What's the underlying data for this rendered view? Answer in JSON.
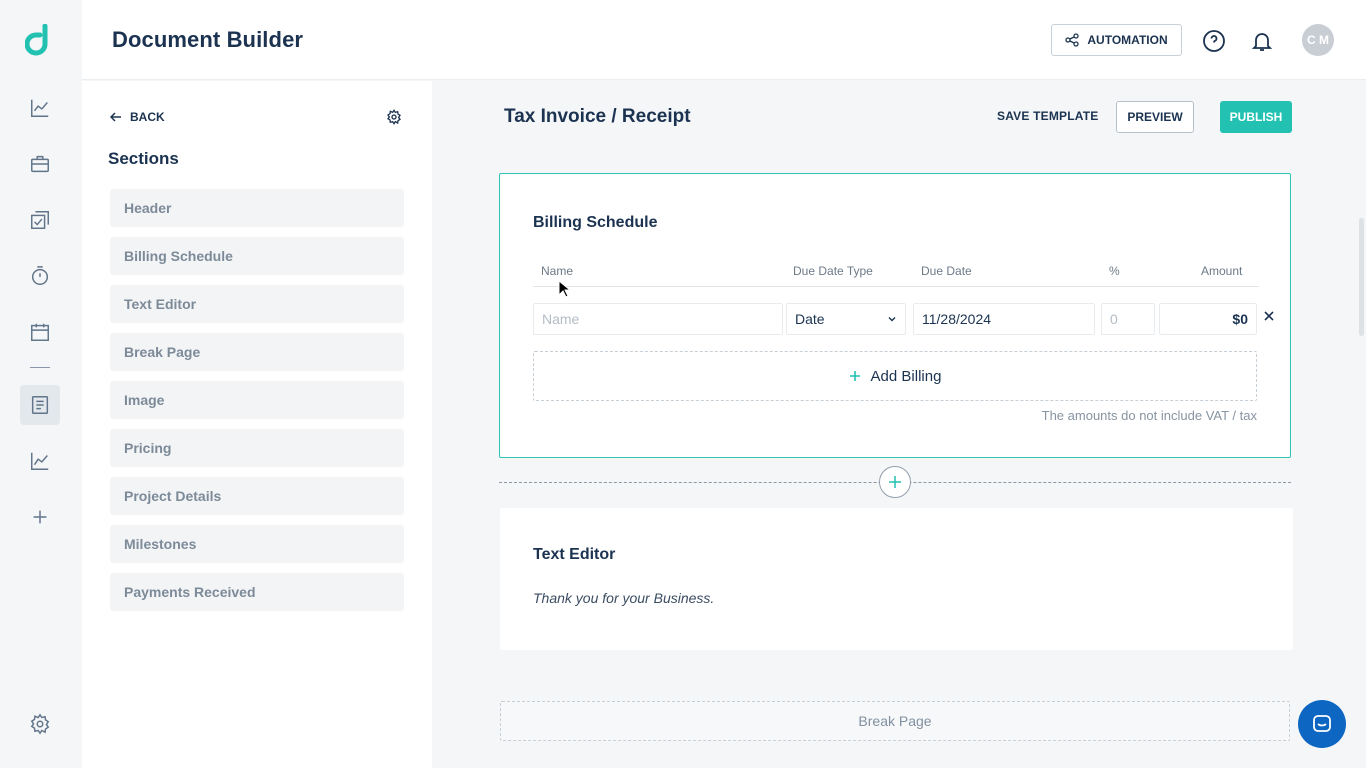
{
  "header": {
    "title": "Document Builder",
    "automation_label": "AUTOMATION",
    "avatar_initials": "C M"
  },
  "sidebar_panel": {
    "back_label": "BACK",
    "sections_title": "Sections",
    "items": [
      {
        "label": "Header"
      },
      {
        "label": "Billing Schedule"
      },
      {
        "label": "Text Editor"
      },
      {
        "label": "Break Page"
      },
      {
        "label": "Image"
      },
      {
        "label": "Pricing"
      },
      {
        "label": "Project Details"
      },
      {
        "label": "Milestones"
      },
      {
        "label": "Payments Received"
      }
    ]
  },
  "document": {
    "title": "Tax Invoice / Receipt",
    "save_template_label": "SAVE TEMPLATE",
    "preview_label": "PREVIEW",
    "publish_label": "PUBLISH"
  },
  "billing": {
    "title": "Billing Schedule",
    "columns": {
      "name": "Name",
      "due_date_type": "Due Date Type",
      "due_date": "Due Date",
      "percent": "%",
      "amount": "Amount"
    },
    "row": {
      "name_placeholder": "Name",
      "due_date_type": "Date",
      "due_date": "11/28/2024",
      "percent_placeholder": "0",
      "amount": "$0"
    },
    "add_label": "Add Billing",
    "note": "The amounts do not include VAT / tax"
  },
  "text_editor": {
    "title": "Text Editor",
    "body": "Thank you for your Business."
  },
  "break_page": {
    "label": "Break Page"
  },
  "icons": {
    "rail": [
      "analytics-icon",
      "briefcase-icon",
      "tasks-icon",
      "timer-icon",
      "calendar-icon",
      "document-icon",
      "reports-icon",
      "add-icon",
      "settings-icon"
    ]
  },
  "colors": {
    "accent": "#22c1b2",
    "navy": "#1b3350",
    "chat": "#0d66c2"
  }
}
